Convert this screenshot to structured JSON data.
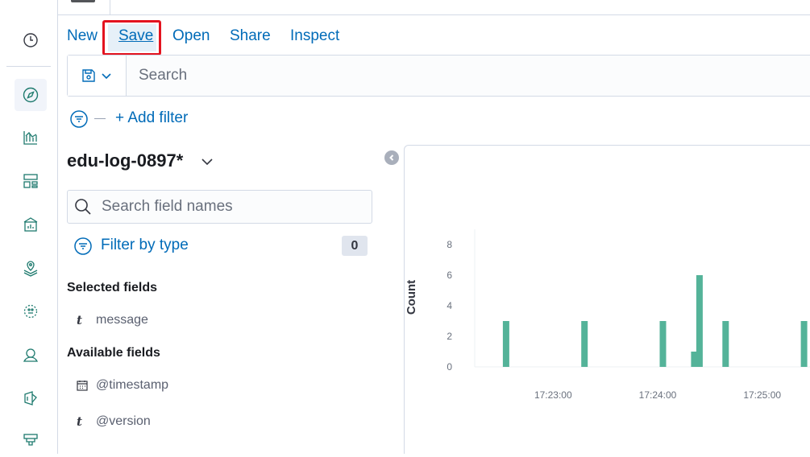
{
  "top_nav": {
    "new": "New",
    "save": "Save",
    "open": "Open",
    "share": "Share",
    "inspect": "Inspect"
  },
  "query": {
    "placeholder": "Search"
  },
  "filters": {
    "add_filter": "+ Add filter"
  },
  "sidebar": {
    "index_pattern": "edu-log-0897*",
    "search_placeholder": "Search field names",
    "filter_by_type": "Filter by type",
    "filter_count": "0",
    "selected_fields_title": "Selected fields",
    "selected_fields": [
      {
        "type": "t",
        "name": "message"
      }
    ],
    "available_fields_title": "Available fields",
    "available_fields": [
      {
        "type": "date",
        "name": "@timestamp"
      },
      {
        "type": "t",
        "name": "@version"
      }
    ]
  },
  "left_nav_icons": [
    "clock-icon",
    "discover-compass-icon",
    "visualize-icon",
    "dashboard-icon",
    "canvas-icon",
    "maps-icon",
    "ml-icon",
    "graph-icon",
    "stack-monitor-icon",
    "infra-icon"
  ],
  "colors": {
    "accent": "#006bb8",
    "bar": "#54b399",
    "highlight": "#e3131f"
  },
  "chart_data": {
    "type": "bar",
    "ylabel": "Count",
    "xlabel": "",
    "y_ticks": [
      "0",
      "2",
      "4",
      "6",
      "8"
    ],
    "ylim": [
      0,
      9
    ],
    "x_tick_labels": [
      "17:23:00",
      "17:24:00",
      "17:25:00"
    ],
    "x_range": [
      "17:22:15",
      "17:25:45"
    ],
    "series": [
      {
        "values": [
          {
            "x": "17:22:33",
            "y": 3
          },
          {
            "x": "17:23:18",
            "y": 3
          },
          {
            "x": "17:24:03",
            "y": 3
          },
          {
            "x": "17:24:21",
            "y": 1
          },
          {
            "x": "17:24:24",
            "y": 6
          },
          {
            "x": "17:24:39",
            "y": 3
          },
          {
            "x": "17:25:24",
            "y": 3
          }
        ]
      }
    ]
  }
}
